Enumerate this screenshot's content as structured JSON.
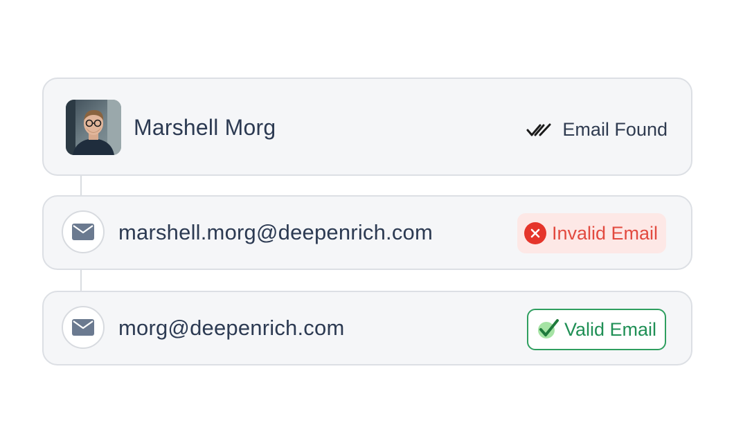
{
  "person": {
    "name": "Marshell Morg",
    "status_label": "Email Found",
    "status_icon": "double-check-icon",
    "avatar_icon": "avatar-photo"
  },
  "emails": [
    {
      "address": "marshell.morg@deepenrich.com",
      "status_label": "Invalid Email",
      "status_icon": "x-circle-icon",
      "status_color": "#e24a3f",
      "badge_bg": "#fde8e6"
    },
    {
      "address": "morg@deepenrich.com",
      "status_label": "Valid Email",
      "status_icon": "check-icon",
      "status_color": "#1f8f55",
      "badge_border": "#2e9e5f"
    }
  ],
  "colors": {
    "card_bg": "#f5f6f8",
    "card_border": "#dcdfe4",
    "text_primary": "#2c3a52",
    "mail_icon": "#6b7a90"
  }
}
